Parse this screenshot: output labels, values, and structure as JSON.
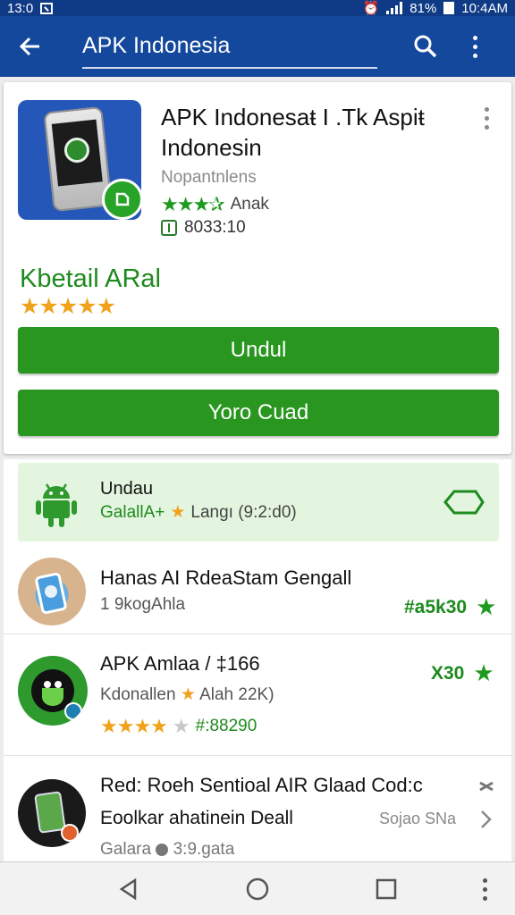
{
  "status_bar": {
    "time": "13:0",
    "battery": "81%",
    "clock": "10:4AM"
  },
  "app_bar": {
    "search_value": "APK Indonesia"
  },
  "app_card": {
    "title": "APK Indonesaŧ I .Tk Aspiŧ Indonesin",
    "publisher": "Nopantnlens",
    "rating_stars": "★★★✰",
    "rating_label": "Anak",
    "size_text": "8033:10",
    "detail_title": "Kbetail ARal",
    "detail_stars": "★★★★★",
    "primary_button": "Undul",
    "secondary_button": "Yoro Cuad"
  },
  "highlight_item": {
    "title": "Undau",
    "sub_left": "GalallA+",
    "sub_star": "★",
    "sub_right": "Langı (9:2:d0)"
  },
  "list_items": [
    {
      "title": "Hanas AI RdeaStam Gengall",
      "subtitle": "1 9kogAhla",
      "price": "#a5k30",
      "price_star": "★"
    },
    {
      "title": "APK Amlaa / ‡166",
      "subtitle_left": "Kdonallen",
      "subtitle_star": "★",
      "subtitle_right": "Alah 22K)",
      "price": "X30",
      "price_star": "★",
      "stars_gold": "★★★★",
      "stars_gray": "★",
      "code": "#:88290"
    },
    {
      "title": "Red: Roeh Sentioal AIR Glaad Cod:c",
      "line2": "Eoolkar ahatinein Deall",
      "line2_right": "Sojao SNa",
      "line3_left": "Galara",
      "line3_right": "3:9.gata"
    }
  ],
  "colors": {
    "app_bar": "#14489c",
    "accent_green": "#28961f",
    "highlight_bg": "#e3f5df",
    "star_gold": "#f0a21c"
  }
}
